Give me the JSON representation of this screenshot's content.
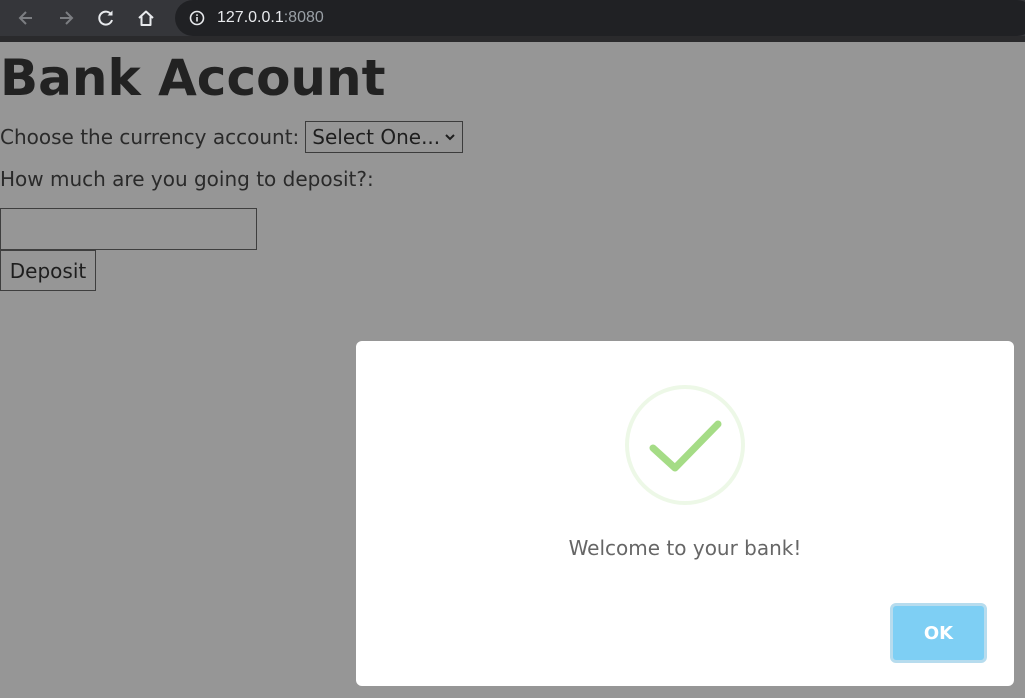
{
  "browser": {
    "url_host": "127.0.0.1",
    "url_port": ":8080",
    "icons": [
      "back-arrow-icon",
      "forward-arrow-icon",
      "reload-icon",
      "home-icon",
      "info-icon"
    ]
  },
  "page": {
    "title": "Bank Account",
    "currency_label": "Choose the currency account:",
    "currency_select": {
      "selected": "Select One..."
    },
    "deposit_label": "How much are you going to deposit?:",
    "amount_value": "",
    "deposit_button": "Deposit"
  },
  "modal": {
    "icon": "success-check-icon",
    "message": "Welcome to your bank!",
    "ok_button": "OK"
  },
  "colors": {
    "overlay_background": "#969696",
    "success_green": "#a5dc86",
    "ok_button": "#7ecff4"
  }
}
